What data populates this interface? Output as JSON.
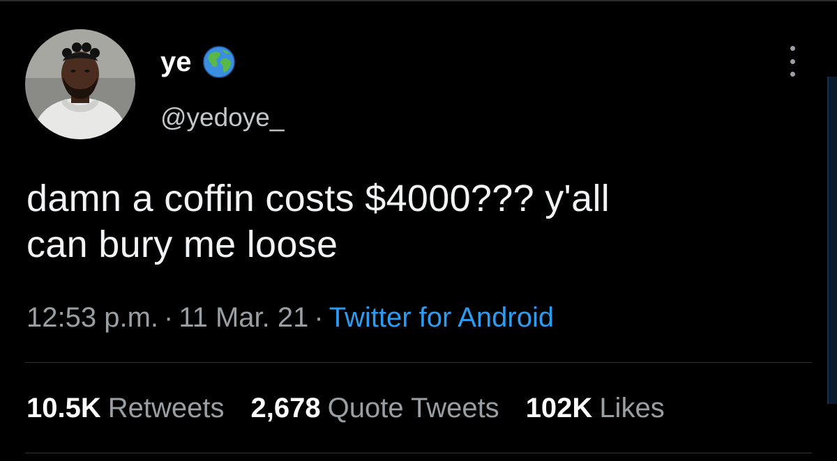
{
  "tweet": {
    "author": {
      "display_name": "ye",
      "handle": "@yedoye_",
      "badge_icon": "globe-icon",
      "avatar_icon": "profile-photo"
    },
    "menu_icon": "more-vertical-icon",
    "text_line1": "damn a coffin costs $4000??? y'all",
    "text_line2": "can bury me loose",
    "time": "12:53 p.m.",
    "separator": "·",
    "date": "11 Mar. 21",
    "source": "Twitter for Android",
    "stats": {
      "retweets_count": "10.5K",
      "retweets_label": "Retweets",
      "quotes_count": "2,678",
      "quotes_label": "Quote Tweets",
      "likes_count": "102K",
      "likes_label": "Likes"
    }
  },
  "colors": {
    "background": "#000000",
    "text": "#f2f3f4",
    "secondary_text": "#9a9fa4",
    "link": "#2b9cf0",
    "divider": "#2f3336"
  }
}
